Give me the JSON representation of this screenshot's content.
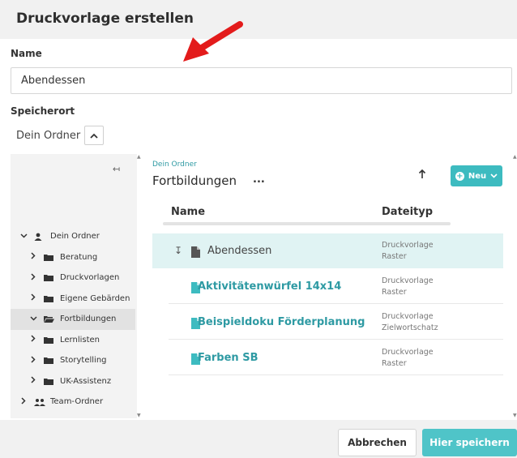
{
  "dialog": {
    "title": "Druckvorlage erstellen"
  },
  "name_field": {
    "label": "Name",
    "value": "Abendessen"
  },
  "location": {
    "label": "Speicherort",
    "current": "Dein Ordner",
    "toggle_icon": "chevron-up-icon"
  },
  "tree": {
    "collapse_icon": "collapse-left-icon",
    "items": [
      {
        "label": "Dein Ordner",
        "level": 0,
        "expanded": true,
        "icon": "user-icon",
        "selected": false
      },
      {
        "label": "Beratung",
        "level": 1,
        "expanded": false,
        "icon": "folder-icon",
        "selected": false
      },
      {
        "label": "Druckvorlagen",
        "level": 1,
        "expanded": false,
        "icon": "folder-icon",
        "selected": false
      },
      {
        "label": "Eigene Gebärden",
        "level": 1,
        "expanded": false,
        "icon": "folder-icon",
        "selected": false
      },
      {
        "label": "Fortbildungen",
        "level": 1,
        "expanded": true,
        "icon": "folder-open-icon",
        "selected": true
      },
      {
        "label": "Lernlisten",
        "level": 1,
        "expanded": false,
        "icon": "folder-icon",
        "selected": false
      },
      {
        "label": "Storytelling",
        "level": 1,
        "expanded": false,
        "icon": "folder-icon",
        "selected": false
      },
      {
        "label": "UK-Assistenz",
        "level": 1,
        "expanded": false,
        "icon": "folder-icon",
        "selected": false
      },
      {
        "label": "Team-Ordner",
        "level": 0,
        "expanded": false,
        "icon": "users-icon",
        "selected": false
      }
    ]
  },
  "content": {
    "breadcrumb": "Dein Ordner",
    "folder_title": "Fortbildungen",
    "more_label": "...",
    "up_icon": "arrow-up-icon",
    "new_button": "Neu",
    "columns": {
      "name": "Name",
      "type": "Dateityp"
    },
    "rows": [
      {
        "name": "Abendessen",
        "type_line1": "Druckvorlage",
        "type_line2": "Raster",
        "active": true
      },
      {
        "name": "Aktivitätenwürfel 14x14",
        "type_line1": "Druckvorlage",
        "type_line2": "Raster",
        "active": false
      },
      {
        "name": "Beispieldoku Förderplanung",
        "type_line1": "Druckvorlage",
        "type_line2": "Zielwortschatz",
        "active": false
      },
      {
        "name": "Farben SB",
        "type_line1": "Druckvorlage",
        "type_line2": "Raster",
        "active": false
      }
    ]
  },
  "footer": {
    "cancel": "Abbrechen",
    "save": "Hier speichern"
  },
  "colors": {
    "accent": "#3dbbc0",
    "link": "#2e9aa3",
    "active_row": "#e0f3f3",
    "arrow": "#e31b1b"
  }
}
